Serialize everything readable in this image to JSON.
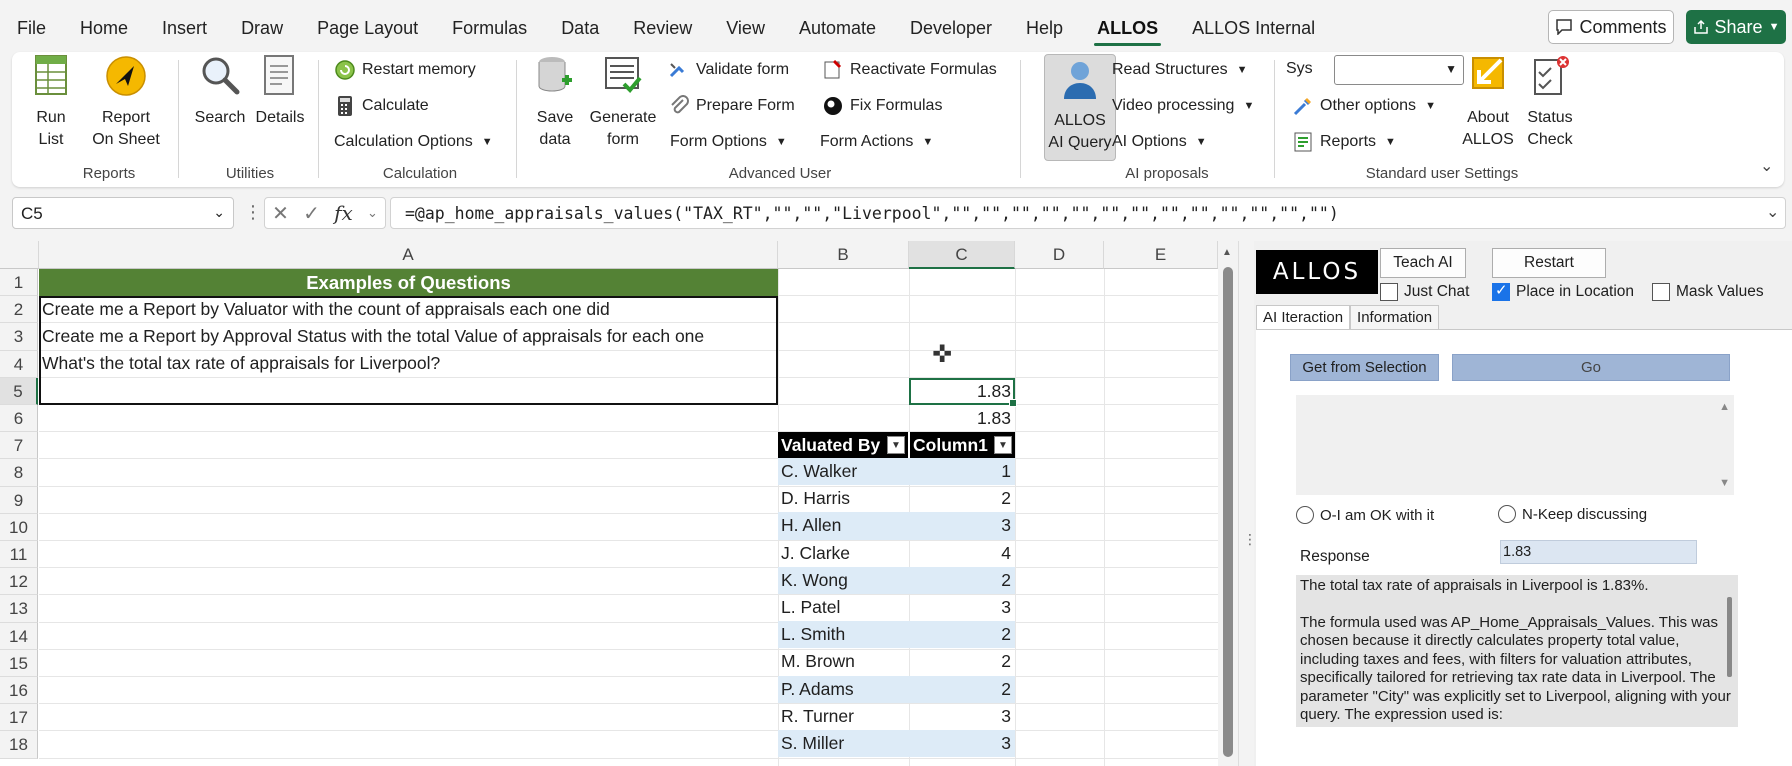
{
  "menu": {
    "tabs": [
      "File",
      "Home",
      "Insert",
      "Draw",
      "Page Layout",
      "Formulas",
      "Data",
      "Review",
      "View",
      "Automate",
      "Developer",
      "Help",
      "ALLOS",
      "ALLOS Internal"
    ],
    "active": "ALLOS",
    "comments_label": "Comments",
    "share_label": "Share"
  },
  "ribbon": {
    "run_list": [
      "Run",
      "List"
    ],
    "report_on_sheet": [
      "Report",
      "On Sheet"
    ],
    "search": "Search",
    "details": "Details",
    "restart_memory": "Restart memory",
    "calculate": "Calculate",
    "calculation_options": "Calculation Options",
    "save_data": [
      "Save",
      "data"
    ],
    "generate_form": [
      "Generate",
      "form"
    ],
    "validate_form": "Validate form",
    "prepare_form": "Prepare Form",
    "form_options": "Form Options",
    "reactivate_formulas": "Reactivate Formulas",
    "fix_formulas": "Fix Formulas",
    "form_actions": "Form Actions",
    "allos_ai_query": [
      "ALLOS",
      "AI Query"
    ],
    "read_structures": "Read Structures",
    "video_processing": "Video processing",
    "ai_options": "AI Options",
    "sys_label": "Sys",
    "other_options": "Other options",
    "reports": "Reports",
    "about_allos": [
      "About",
      "ALLOS"
    ],
    "status_check": [
      "Status",
      "Check"
    ],
    "groups": {
      "reports": "Reports",
      "utilities": "Utilities",
      "calculation": "Calculation",
      "advanced_user": "Advanced User",
      "ai_proposals": "AI proposals",
      "standard_user_settings": "Standard user Settings"
    }
  },
  "formula_bar": {
    "name_box": "C5",
    "fx": "fx",
    "formula": "=@ap_home_appraisals_values(\"TAX_RT\",\"\",\"\",\"Liverpool\",\"\",\"\",\"\",\"\",\"\",\"\",\"\",\"\",\"\",\"\",\"\",\"\",\"\")"
  },
  "sheet": {
    "columns": [
      "A",
      "B",
      "C",
      "D",
      "E"
    ],
    "rows": [
      "1",
      "2",
      "3",
      "4",
      "5",
      "6",
      "7",
      "8",
      "9",
      "10",
      "11",
      "12",
      "13",
      "14",
      "15",
      "16",
      "17",
      "18"
    ],
    "title": "Examples of Questions",
    "questions": [
      "Create me a Report by Valuator with the count of appraisals each one did",
      "Create me a Report by Approval Status with the total Value of appraisals for each one",
      "What's the total tax rate of appraisals for Liverpool?"
    ],
    "c5": "1.83",
    "c6": "1.83",
    "table_headers": [
      "Valuated By",
      "Column1"
    ],
    "table_rows": [
      {
        "name": "C. Walker",
        "value": "1"
      },
      {
        "name": "D. Harris",
        "value": "2"
      },
      {
        "name": "H. Allen",
        "value": "3"
      },
      {
        "name": "J. Clarke",
        "value": "4"
      },
      {
        "name": "K. Wong",
        "value": "2"
      },
      {
        "name": "L. Patel",
        "value": "3"
      },
      {
        "name": "L. Smith",
        "value": "2"
      },
      {
        "name": "M. Brown",
        "value": "2"
      },
      {
        "name": "P. Adams",
        "value": "2"
      },
      {
        "name": "R. Turner",
        "value": "3"
      },
      {
        "name": "S. Miller",
        "value": "3"
      }
    ]
  },
  "pane": {
    "logo": "ALLOS",
    "teach_ai": "Teach AI",
    "restart": "Restart",
    "just_chat": "Just Chat",
    "place_in_location": "Place in Location",
    "mask_values": "Mask Values",
    "tab_ai_iteraction": "AI Iteraction",
    "tab_information": "Information",
    "get_from_selection": "Get from Selection",
    "go": "Go",
    "radio_ok": "O-I am OK with it",
    "radio_keep": "N-Keep discussing",
    "response_label": "Response",
    "response_value": "1.83",
    "answer_p1": "The total tax rate of appraisals in Liverpool is 1.83%.",
    "answer_p2": "The formula used was AP_Home_Appraisals_Values. This was chosen because it directly calculates property total value, including taxes and fees, with filters for valuation attributes, specifically tailored for retrieving tax rate data in Liverpool. The parameter \"City\" was explicitly set to Liverpool, aligning with your query. The expression used is:"
  },
  "colors": {
    "excel_green": "#1e7145",
    "title_green": "#548235",
    "band_blue": "#ddebf7",
    "button_blue": "#9fb5d6"
  }
}
